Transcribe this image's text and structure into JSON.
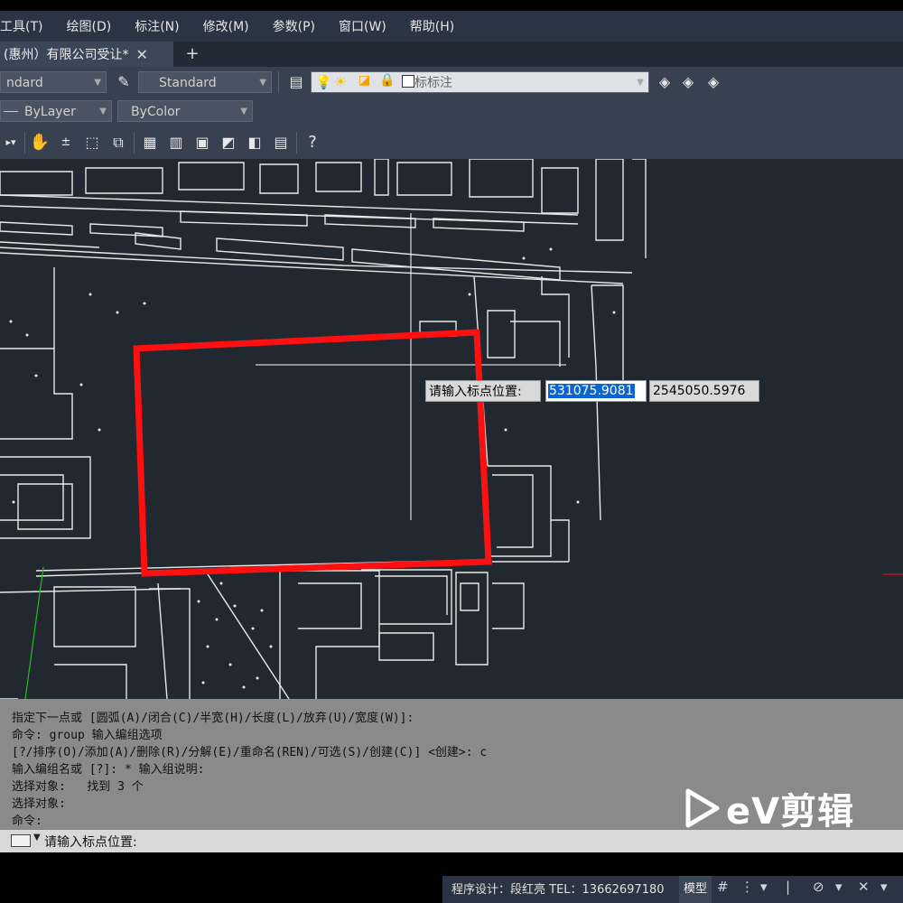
{
  "menu": [
    "工具(T)",
    "绘图(D)",
    "标注(N)",
    "修改(M)",
    "参数(P)",
    "窗口(W)",
    "帮助(H)"
  ],
  "tab": {
    "title": "(惠州）有限公司受让*",
    "close": "✕",
    "add": "+"
  },
  "toolbar1": {
    "text_style": "ndard",
    "dim_style": "Standard",
    "layer": "坐标标注"
  },
  "toolbar2": {
    "linetype": "ByLayer",
    "color": "ByColor"
  },
  "prompt": {
    "label": "请输入标点位置:",
    "x_value": "531075.9081",
    "y_value": "2545050.5976"
  },
  "command_history": [
    "指定下一点或 [圆弧(A)/闭合(C)/半宽(H)/长度(L)/放弃(U)/宽度(W)]:",
    "命令: group 输入编组选项",
    "[?/排序(O)/添加(A)/删除(R)/分解(E)/重命名(REN)/可选(S)/创建(C)] <创建>: c",
    "输入编组名或 [?]: * 输入组说明:",
    "选择对象:   找到 3 个",
    "选择对象:",
    "命令:"
  ],
  "command_input": "请输入标点位置:",
  "status": {
    "text": "程序设计：段红亮 TEL：13662697180",
    "model": "模型"
  },
  "watermark": "eV剪辑",
  "colors": {
    "highlight_rect": "#ff1010",
    "canvas_bg": "#212830",
    "selection": "#0a64d4"
  }
}
